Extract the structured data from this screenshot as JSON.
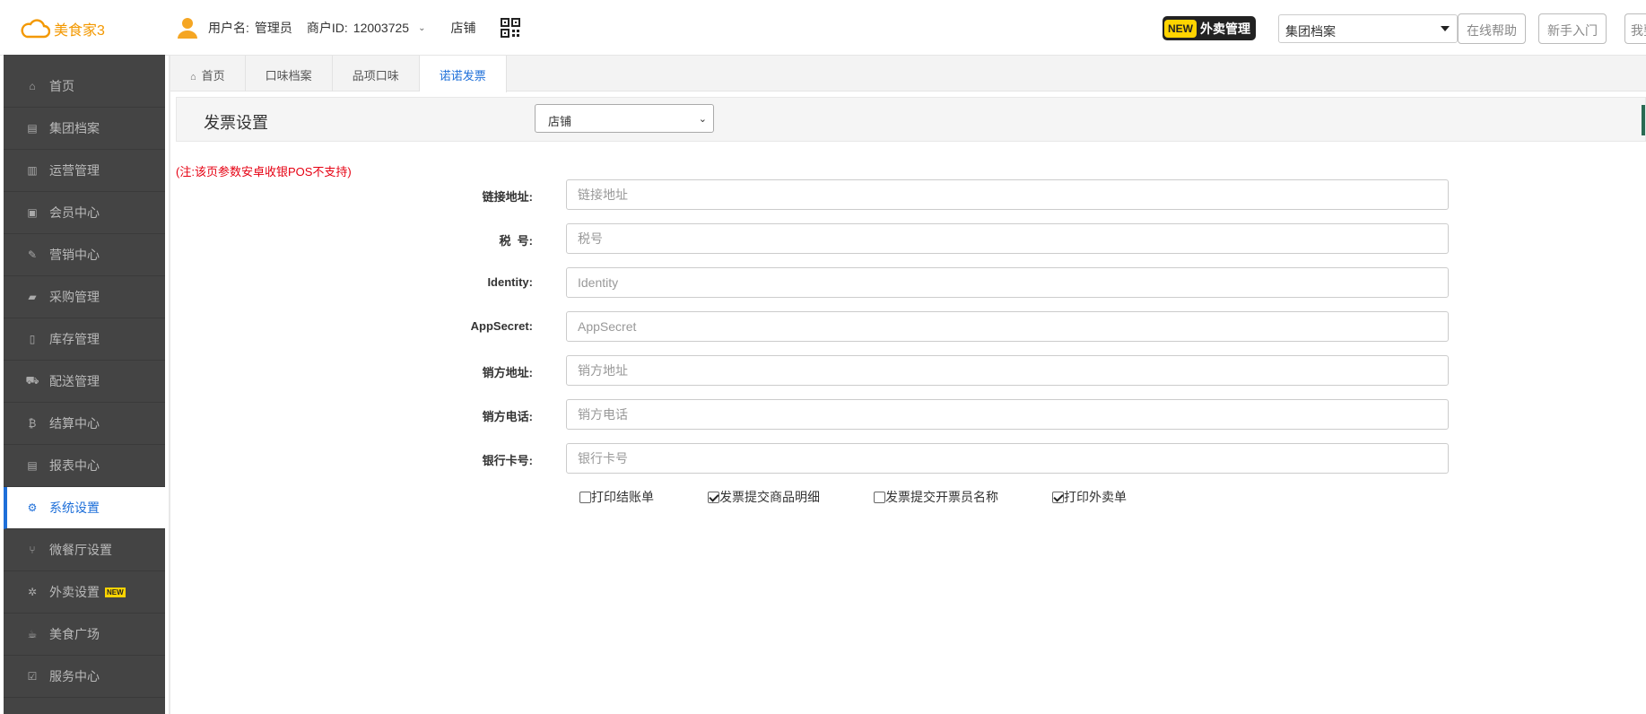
{
  "brand": {
    "name": "美食家3",
    "color": "#f39800"
  },
  "topbar": {
    "user_label": "用户名:",
    "user_value": "管理员",
    "merchant_label": "商户ID:",
    "merchant_value": "12003725",
    "store_label": "店铺",
    "new_badge": "NEW",
    "takeout_label": "外卖管理",
    "group_select_value": "集团档案",
    "help_button": "在线帮助",
    "newbie_button": "新手入门",
    "cut_button": "我要"
  },
  "sidebar": {
    "items": [
      {
        "label": "首页",
        "icon": "home-icon",
        "glyph": "⌂"
      },
      {
        "label": "集团档案",
        "icon": "file-icon",
        "glyph": "▤"
      },
      {
        "label": "运营管理",
        "icon": "bar-chart-icon",
        "glyph": "▥"
      },
      {
        "label": "会员中心",
        "icon": "id-card-icon",
        "glyph": "▣"
      },
      {
        "label": "营销中心",
        "icon": "edit-icon",
        "glyph": "✎"
      },
      {
        "label": "采购管理",
        "icon": "book-icon",
        "glyph": "▰"
      },
      {
        "label": "库存管理",
        "icon": "document-icon",
        "glyph": "▯"
      },
      {
        "label": "配送管理",
        "icon": "truck-icon",
        "glyph": "⛟"
      },
      {
        "label": "结算中心",
        "icon": "bitcoin-icon",
        "glyph": "₿"
      },
      {
        "label": "报表中心",
        "icon": "report-icon",
        "glyph": "▤"
      },
      {
        "label": "系统设置",
        "icon": "cogs-icon",
        "glyph": "⚙"
      },
      {
        "label": "微餐厅设置",
        "icon": "cutlery-icon",
        "glyph": "⑂"
      },
      {
        "label": "外卖设置",
        "icon": "gear-icon",
        "glyph": "✲",
        "tag": "NEW"
      },
      {
        "label": "美食广场",
        "icon": "coffee-icon",
        "glyph": "☕"
      },
      {
        "label": "服务中心",
        "icon": "checkbox-icon",
        "glyph": "☑"
      }
    ],
    "active_index": 10,
    "accent": "#1e6fd9"
  },
  "tabs": [
    {
      "label": "首页"
    },
    {
      "label": "口味档案"
    },
    {
      "label": "品项口味"
    },
    {
      "label": "诺诺发票"
    }
  ],
  "page": {
    "title": "发票设置",
    "store_select": "店铺",
    "note": "(注:该页参数安卓收银POS不支持)"
  },
  "form": {
    "fields": [
      {
        "label": "链接地址:",
        "placeholder": "链接地址"
      },
      {
        "label": "税  号:",
        "placeholder": "税号"
      },
      {
        "label": "Identity:",
        "placeholder": "Identity"
      },
      {
        "label": "AppSecret:",
        "placeholder": "AppSecret"
      },
      {
        "label": "销方地址:",
        "placeholder": "销方地址"
      },
      {
        "label": "销方电话:",
        "placeholder": "销方电话"
      },
      {
        "label": "银行卡号:",
        "placeholder": "银行卡号"
      }
    ],
    "checkboxes": [
      {
        "label": "打印结账单",
        "checked": false
      },
      {
        "label": "发票提交商品明细",
        "checked": true
      },
      {
        "label": "发票提交开票员名称",
        "checked": false
      },
      {
        "label": "打印外卖单",
        "checked": true
      }
    ]
  },
  "colors": {
    "note": "#e60012",
    "sidebar_bg": "#444444"
  }
}
